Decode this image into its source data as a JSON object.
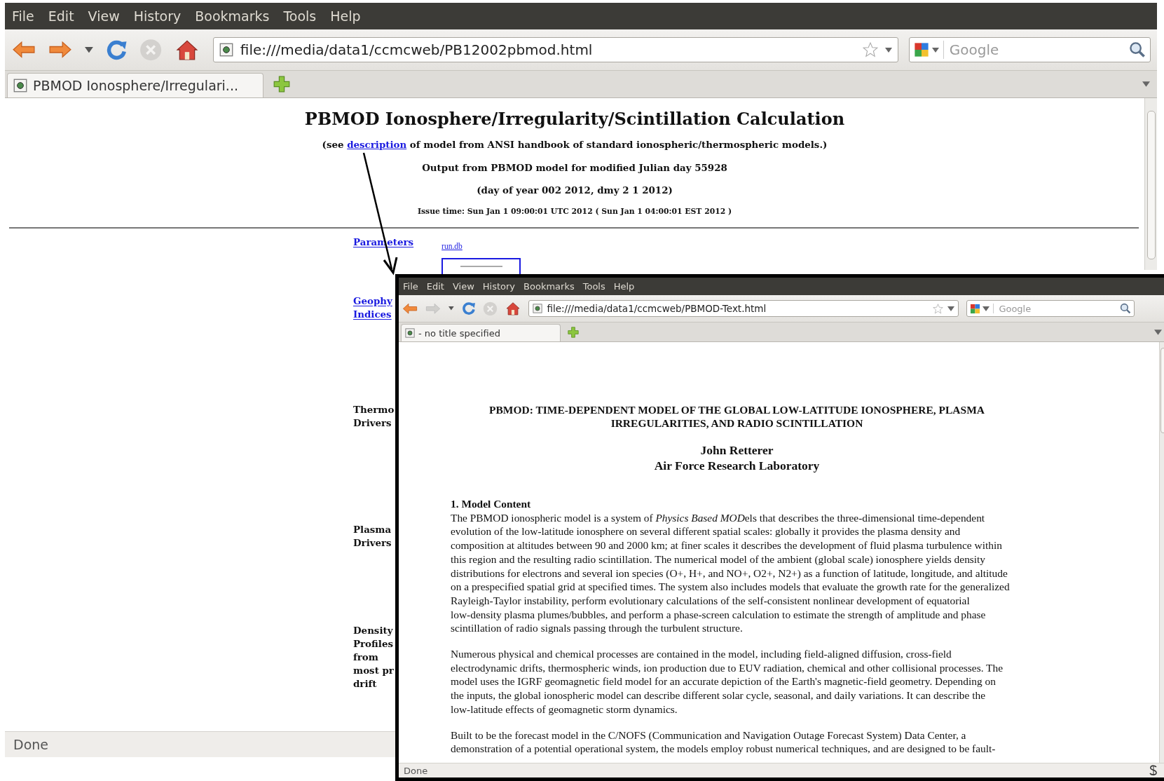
{
  "main_window": {
    "menu": [
      "File",
      "Edit",
      "View",
      "History",
      "Bookmarks",
      "Tools",
      "Help"
    ],
    "nav_buttons": [
      {
        "kind": "back",
        "disabled": false
      },
      {
        "kind": "forward",
        "disabled": false
      },
      {
        "kind": "history",
        "disabled": false
      },
      {
        "kind": "reload",
        "disabled": false
      },
      {
        "kind": "stop",
        "disabled": true
      },
      {
        "kind": "home",
        "disabled": false
      }
    ],
    "url": "file:///media/data1/ccmcweb/PB12002pbmod.html",
    "search": {
      "placeholder": "Google"
    },
    "tabs": [
      {
        "label": "PBMOD Ionosphere/Irregulari...",
        "selected": true
      }
    ],
    "page": {
      "title": "PBMOD Ionosphere/Irregularity/Scintillation Calculation",
      "description": {
        "before": "(see ",
        "link": "description",
        "after": " of model from ANSI handbook of standard ionospheric/thermospheric models.)"
      },
      "output_line": "Output from PBMOD model for modified Julian day 55928",
      "date_line": "(day of year 002 2012, dmy 2 1 2012)",
      "issue_time": "Issue time: Sun Jan 1 09:00:01 UTC 2012 ( Sun Jan 1 04:00:01 EST 2012 )",
      "rows": [
        {
          "kind": "link",
          "lines": [
            "Parameters"
          ],
          "side_link": "run.db"
        },
        {
          "kind": "link",
          "lines": [
            "Geophy",
            "Indices"
          ]
        },
        {
          "kind": "heading",
          "lines": [
            "Thermo",
            "Drivers"
          ]
        },
        {
          "kind": "heading",
          "lines": [
            "Plasma",
            "Drivers"
          ]
        },
        {
          "kind": "heading",
          "lines": [
            "Density",
            "Profiles",
            "from",
            "most pr",
            "drift"
          ]
        }
      ]
    },
    "status_bar": "Done"
  },
  "inset_window": {
    "menu": [
      "File",
      "Edit",
      "View",
      "History",
      "Bookmarks",
      "Tools",
      "Help"
    ],
    "nav_buttons": [
      {
        "kind": "back",
        "disabled": false
      },
      {
        "kind": "forward",
        "disabled": true
      },
      {
        "kind": "history",
        "disabled": false
      },
      {
        "kind": "reload",
        "disabled": false
      },
      {
        "kind": "stop",
        "disabled": true
      },
      {
        "kind": "home",
        "disabled": false
      }
    ],
    "url": "file:///media/data1/ccmcweb/PBMOD-Text.html",
    "search": {
      "placeholder": "Google"
    },
    "tabs": [
      {
        "label": "- no title specified",
        "selected": true
      }
    ],
    "page": {
      "heading": [
        "PBMOD: TIME-DEPENDENT MODEL OF THE GLOBAL LOW-LATITUDE IONOSPHERE, PLASMA",
        "IRREGULARITIES, AND RADIO SCINTILLATION"
      ],
      "author": "John Retterer",
      "affiliation": "Air Force Research Laboratory",
      "section": "1. Model Content",
      "paragraphs": [
        [
          [
            {
              "text": "The PBMOD ionospheric model is a system of "
            },
            {
              "text": "Physics Based MOD",
              "italic": true
            },
            {
              "text": "els that describes the three-dimensional time-dependent"
            }
          ],
          "evolution of the low-latitude ionosphere on several different spatial scales: globally it provides the plasma density and",
          "composition at altitudes between 90 and 2000 km; at finer scales it describes the development of fluid plasma turbulence within",
          "this region and the resulting radio scintillation. The numerical model of the ambient (global scale) ionosphere yields density",
          "distributions for electrons and several ion species (O+, H+, and NO+, O2+, N2+) as a function of latitude, longitude, and altitude",
          "on a prespecified spatial grid at specified times. The system also includes models that evaluate the growth rate for the generalized",
          "Rayleigh-Taylor instability, perform evolutionary calculations of the self-consistent nonlinear development of equatorial",
          "low-density plasma plumes/bubbles, and perform a phase-screen calculation to estimate the strength of amplitude and phase",
          "scintillation of radio signals passing through the turbulent structure."
        ],
        [
          "Numerous physical and chemical processes are contained in the model, including field-aligned diffusion, cross-field",
          "electrodynamic drifts, thermospheric winds, ion production due to EUV radiation, chemical and other collisional processes.  The",
          "model uses the IGRF geomagnetic field model for an accurate depiction of the Earth's magnetic-field geometry.  Depending on",
          "the inputs, the global ionospheric model can describe different solar cycle, seasonal, and daily variations. It can describe the",
          "low-latitude effects of geomagnetic storm dynamics."
        ],
        [
          "Built to be the forecast model in the C/NOFS (Communication and Navigation Outage Forecast System) Data Center, a",
          "demonstration of a potential operational system, the models employ robust numerical techniques, and are designed to be fault-"
        ]
      ]
    },
    "status_bar": "Done"
  }
}
